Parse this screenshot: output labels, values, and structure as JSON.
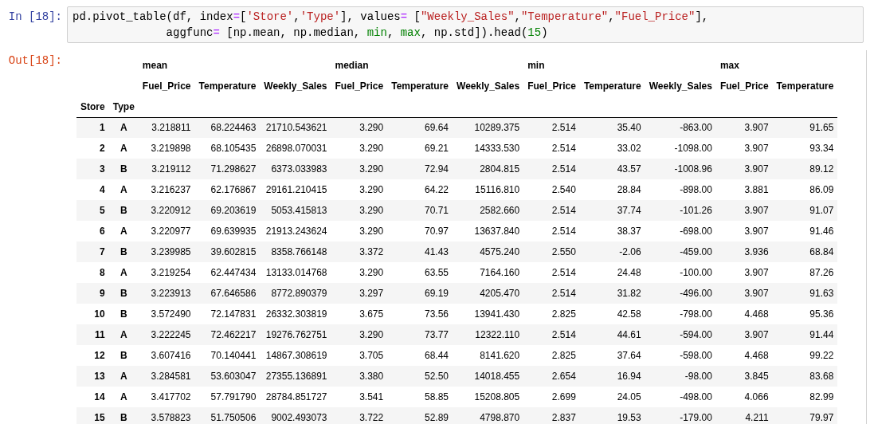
{
  "input_prompt": "In [18]:",
  "code_lines": [
    [
      {
        "kind": "plain",
        "text": "pd.pivot_table(df, index"
      },
      {
        "kind": "operator",
        "text": "="
      },
      {
        "kind": "plain",
        "text": "["
      },
      {
        "kind": "string",
        "text": "'Store'"
      },
      {
        "kind": "plain",
        "text": ","
      },
      {
        "kind": "string",
        "text": "'Type'"
      },
      {
        "kind": "plain",
        "text": "], values"
      },
      {
        "kind": "operator",
        "text": "="
      },
      {
        "kind": "plain",
        "text": " ["
      },
      {
        "kind": "string",
        "text": "\"Weekly_Sales\""
      },
      {
        "kind": "plain",
        "text": ","
      },
      {
        "kind": "string",
        "text": "\"Temperature\""
      },
      {
        "kind": "plain",
        "text": ","
      },
      {
        "kind": "string",
        "text": "\"Fuel_Price\""
      },
      {
        "kind": "plain",
        "text": "],"
      }
    ],
    [
      {
        "kind": "plain",
        "text": "              aggfunc"
      },
      {
        "kind": "operator",
        "text": "="
      },
      {
        "kind": "plain",
        "text": " [np.mean, np.median, "
      },
      {
        "kind": "builtin",
        "text": "min"
      },
      {
        "kind": "plain",
        "text": ", "
      },
      {
        "kind": "builtin",
        "text": "max"
      },
      {
        "kind": "plain",
        "text": ", np.std]).head("
      },
      {
        "kind": "number",
        "text": "15"
      },
      {
        "kind": "plain",
        "text": ")"
      }
    ]
  ],
  "output_prompt": "Out[18]:",
  "table": {
    "column_groups": [
      {
        "label": "mean",
        "columns": [
          "Fuel_Price",
          "Temperature",
          "Weekly_Sales"
        ]
      },
      {
        "label": "median",
        "columns": [
          "Fuel_Price",
          "Temperature",
          "Weekly_Sales"
        ]
      },
      {
        "label": "min",
        "columns": [
          "Fuel_Price",
          "Temperature",
          "Weekly_Sales"
        ]
      },
      {
        "label": "max",
        "columns": [
          "Fuel_Price",
          "Temperature"
        ]
      }
    ],
    "index_names": [
      "Store",
      "Type"
    ],
    "rows": [
      {
        "index": [
          "1",
          "A"
        ],
        "values": [
          "3.218811",
          "68.224463",
          "21710.543621",
          "3.290",
          "69.64",
          "10289.375",
          "2.514",
          "35.40",
          "-863.00",
          "3.907",
          "91.65"
        ]
      },
      {
        "index": [
          "2",
          "A"
        ],
        "values": [
          "3.219898",
          "68.105435",
          "26898.070031",
          "3.290",
          "69.21",
          "14333.530",
          "2.514",
          "33.02",
          "-1098.00",
          "3.907",
          "93.34"
        ]
      },
      {
        "index": [
          "3",
          "B"
        ],
        "values": [
          "3.219112",
          "71.298627",
          "6373.033983",
          "3.290",
          "72.94",
          "2804.815",
          "2.514",
          "43.57",
          "-1008.96",
          "3.907",
          "89.12"
        ]
      },
      {
        "index": [
          "4",
          "A"
        ],
        "values": [
          "3.216237",
          "62.176867",
          "29161.210415",
          "3.290",
          "64.22",
          "15116.810",
          "2.540",
          "28.84",
          "-898.00",
          "3.881",
          "86.09"
        ]
      },
      {
        "index": [
          "5",
          "B"
        ],
        "values": [
          "3.220912",
          "69.203619",
          "5053.415813",
          "3.290",
          "70.71",
          "2582.660",
          "2.514",
          "37.74",
          "-101.26",
          "3.907",
          "91.07"
        ]
      },
      {
        "index": [
          "6",
          "A"
        ],
        "values": [
          "3.220977",
          "69.639935",
          "21913.243624",
          "3.290",
          "70.97",
          "13637.840",
          "2.514",
          "38.37",
          "-698.00",
          "3.907",
          "91.46"
        ]
      },
      {
        "index": [
          "7",
          "B"
        ],
        "values": [
          "3.239985",
          "39.602815",
          "8358.766148",
          "3.372",
          "41.43",
          "4575.240",
          "2.550",
          "-2.06",
          "-459.00",
          "3.936",
          "68.84"
        ]
      },
      {
        "index": [
          "8",
          "A"
        ],
        "values": [
          "3.219254",
          "62.447434",
          "13133.014768",
          "3.290",
          "63.55",
          "7164.160",
          "2.514",
          "24.48",
          "-100.00",
          "3.907",
          "87.26"
        ]
      },
      {
        "index": [
          "9",
          "B"
        ],
        "values": [
          "3.223913",
          "67.646586",
          "8772.890379",
          "3.297",
          "69.19",
          "4205.470",
          "2.514",
          "31.82",
          "-496.00",
          "3.907",
          "91.63"
        ]
      },
      {
        "index": [
          "10",
          "B"
        ],
        "values": [
          "3.572490",
          "72.147831",
          "26332.303819",
          "3.675",
          "73.56",
          "13941.430",
          "2.825",
          "42.58",
          "-798.00",
          "4.468",
          "95.36"
        ]
      },
      {
        "index": [
          "11",
          "A"
        ],
        "values": [
          "3.222245",
          "72.462217",
          "19276.762751",
          "3.290",
          "73.77",
          "12322.110",
          "2.514",
          "44.61",
          "-594.00",
          "3.907",
          "91.44"
        ]
      },
      {
        "index": [
          "12",
          "B"
        ],
        "values": [
          "3.607416",
          "70.140441",
          "14867.308619",
          "3.705",
          "68.44",
          "8141.620",
          "2.825",
          "37.64",
          "-598.00",
          "4.468",
          "99.22"
        ]
      },
      {
        "index": [
          "13",
          "A"
        ],
        "values": [
          "3.284581",
          "53.603047",
          "27355.136891",
          "3.380",
          "52.50",
          "14018.455",
          "2.654",
          "16.94",
          "-98.00",
          "3.845",
          "83.68"
        ]
      },
      {
        "index": [
          "14",
          "A"
        ],
        "values": [
          "3.417702",
          "57.791790",
          "28784.851727",
          "3.541",
          "58.85",
          "15208.805",
          "2.699",
          "24.05",
          "-498.00",
          "4.066",
          "82.99"
        ]
      },
      {
        "index": [
          "15",
          "B"
        ],
        "values": [
          "3.578823",
          "51.750506",
          "9002.493073",
          "3.722",
          "52.89",
          "4798.870",
          "2.837",
          "19.53",
          "-179.00",
          "4.211",
          "79.97"
        ]
      }
    ]
  }
}
